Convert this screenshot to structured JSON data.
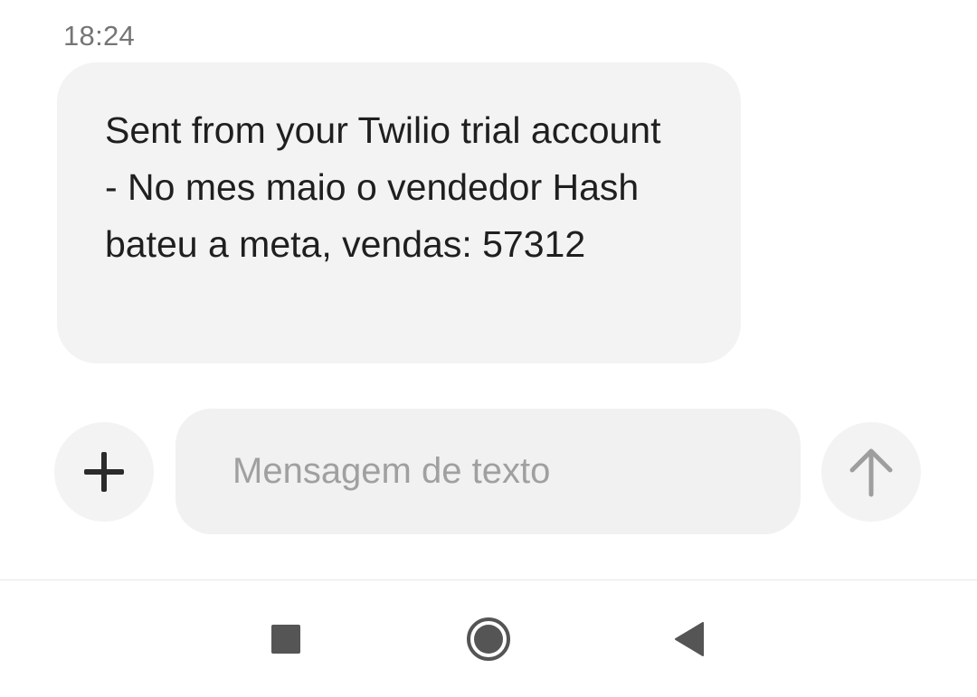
{
  "conversation": {
    "timestamp": "18:24",
    "message": {
      "text": "Sent from your Twilio trial account - No mes maio o vendedor Hash bateu a meta, vendas: 57312",
      "direction": "incoming"
    }
  },
  "composer": {
    "placeholder": "Mensagem de texto",
    "value": "",
    "add_icon": "plus-icon",
    "send_icon": "arrow-up-icon"
  },
  "navbar": {
    "recents_icon": "square-icon",
    "home_icon": "circle-icon",
    "back_icon": "triangle-back-icon"
  },
  "colors": {
    "bubble_bg": "#f3f3f3",
    "input_bg": "#f1f1f1",
    "text": "#1f1f1f",
    "timestamp": "#757575",
    "placeholder": "#a0a0a0",
    "nav_icon": "#555555"
  }
}
